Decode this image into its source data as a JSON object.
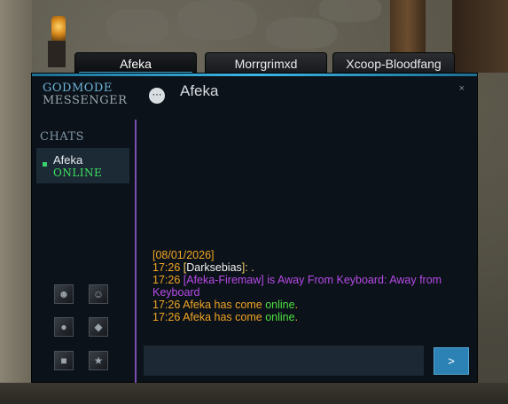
{
  "tabs": [
    {
      "label": "Afeka",
      "active": true
    },
    {
      "label": "Morrgrimxd",
      "active": false
    },
    {
      "label": "Xcoop-Bloodfang",
      "active": false
    }
  ],
  "brand": {
    "line1": "GODMODE",
    "line2": "MESSENGER"
  },
  "header": {
    "title": "Afeka",
    "close": "×"
  },
  "sidebar": {
    "heading": "CHATS",
    "contact": {
      "name": "Afeka",
      "status": "ONLINE"
    }
  },
  "icons": [
    "portrait-icon-1",
    "portrait-icon-2",
    "portrait-icon-3",
    "portrait-icon-4",
    "portrait-icon-5",
    "portrait-icon-6"
  ],
  "log": {
    "date": "[08/01/2026]",
    "l1_time": "17:26",
    "l1_open": "[",
    "l1_name": "Darksebias",
    "l1_close": "]: .",
    "l2_time": "17:26",
    "l2_text": "[Afeka-Firemaw] is Away From Keyboard: Away from Keyboard",
    "l3_time": "17:26",
    "l3_text": "Afeka has come",
    "l3_status": "online",
    "l3_dot": ".",
    "l4_time": "17:26",
    "l4_text": "Afeka has come",
    "l4_status": "online",
    "l4_dot": "."
  },
  "input": {
    "value": "",
    "placeholder": ""
  },
  "send_label": ">",
  "colors": {
    "accent": "#3cb6e6",
    "online": "#3ee05e",
    "divider": "#7b4fb2",
    "send": "#2d82b5"
  }
}
